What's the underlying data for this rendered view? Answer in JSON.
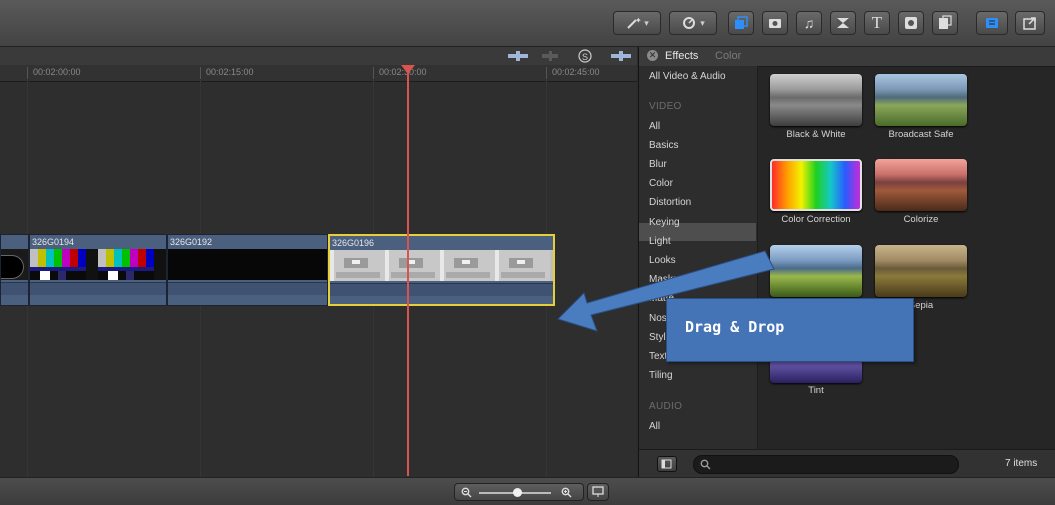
{
  "toolbar": {
    "icons": [
      "magic-wand-icon",
      "retime-icon",
      "effects-browser-icon",
      "photos-icon",
      "music-icon",
      "transitions-icon",
      "titles-icon",
      "generators-icon",
      "themes-icon",
      "inspector-icon",
      "share-icon"
    ]
  },
  "timeline": {
    "ruler_ticks": [
      "00:02:00:00",
      "00:02:15:00",
      "00:02:30:00",
      "00:02:45:00"
    ],
    "clips": [
      {
        "name": ""
      },
      {
        "name": "326G0194"
      },
      {
        "name": "326G0192"
      },
      {
        "name": "326G0196"
      }
    ],
    "playhead_color": "#d9534f",
    "selected_clip_color": "#e6d03a"
  },
  "browser": {
    "tab_active": "Effects",
    "tab_inactive": "Color",
    "categories": {
      "all_video_audio": "All Video & Audio",
      "video_header": "VIDEO",
      "video": [
        "All",
        "Basics",
        "Blur",
        "Color",
        "Distortion",
        "Keying",
        "Light",
        "Looks",
        "Masks",
        "Matte",
        "Nostalgia",
        "Stylize",
        "Text Effects",
        "Tiling"
      ],
      "audio_header": "AUDIO",
      "audio": [
        "All"
      ],
      "selected": "Color"
    },
    "effects": [
      {
        "label": "Black & White"
      },
      {
        "label": "Broadcast Safe"
      },
      {
        "label": "Color Correction"
      },
      {
        "label": "Colorize"
      },
      {
        "label": ""
      },
      {
        "label": "Sepia"
      },
      {
        "label": "Tint"
      }
    ],
    "footer": {
      "search_placeholder": "",
      "count": "7 items"
    }
  },
  "callout": {
    "text": "Drag & Drop",
    "color": "#4473b6"
  }
}
